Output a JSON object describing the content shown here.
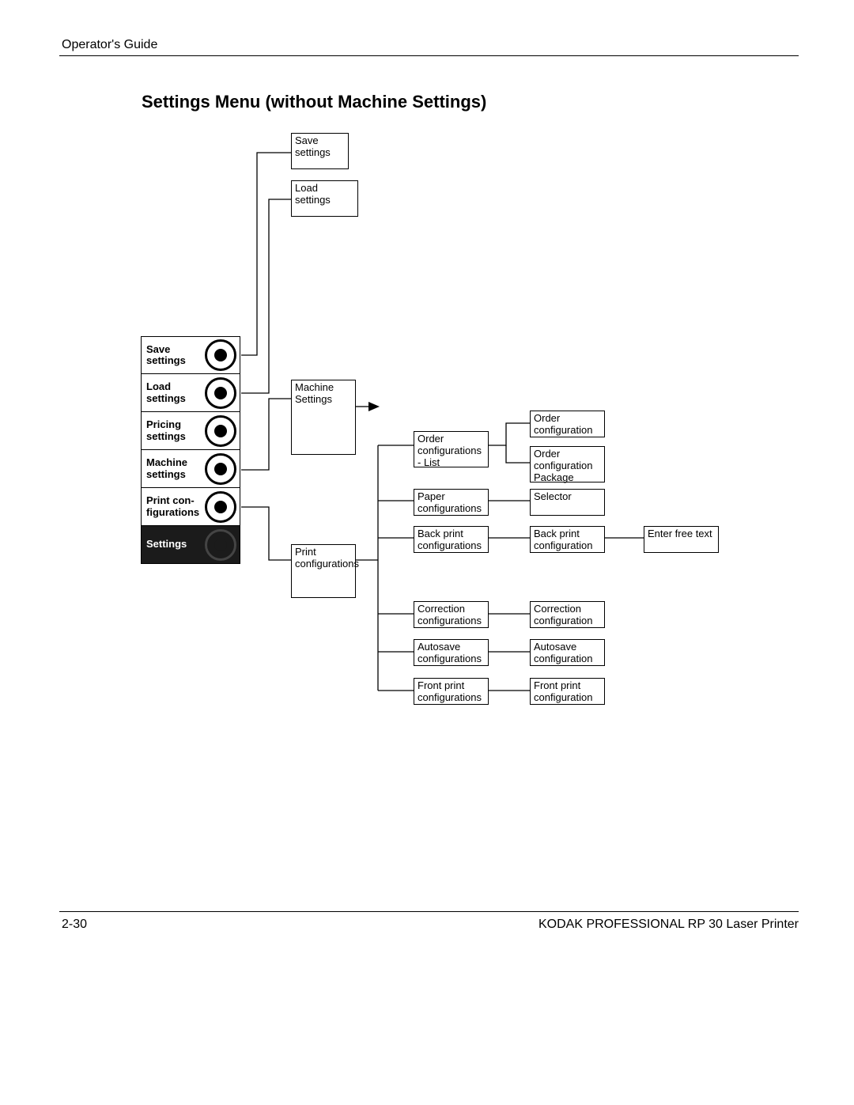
{
  "header": {
    "guide": "Operator's Guide"
  },
  "title": "Settings Menu (without Machine Settings)",
  "footer": {
    "page": "2-30",
    "product": "KODAK PROFESSIONAL RP 30 Laser Printer"
  },
  "menu": {
    "items": [
      {
        "label": "Save settings"
      },
      {
        "label": "Load settings"
      },
      {
        "label": "Pricing settings"
      },
      {
        "label": "Machine settings"
      },
      {
        "label": "Print con-\nfigurations"
      },
      {
        "label": "Settings"
      }
    ]
  },
  "boxes": {
    "save_settings": "Save settings",
    "load_settings": "Load settings",
    "machine_settings": "Machine Settings",
    "print_configurations": "Print configurations",
    "order_configs_list": "Order configurations - List",
    "paper_configs": "Paper configurations",
    "backprint_configs": "Back print configurations",
    "correction_configs": "Correction configurations",
    "autosave_configs": "Autosave configurations",
    "frontprint_configs": "Front print configurations",
    "order_configuration": "Order configuration",
    "order_configuration_package": "Order configuration Package",
    "selector": "Selector",
    "backprint_configuration": "Back print configuration",
    "correction_configuration": "Correction configuration",
    "autosave_configuration": "Autosave configuration",
    "frontprint_configuration": "Front print configuration",
    "enter_free_text": "Enter free text"
  }
}
